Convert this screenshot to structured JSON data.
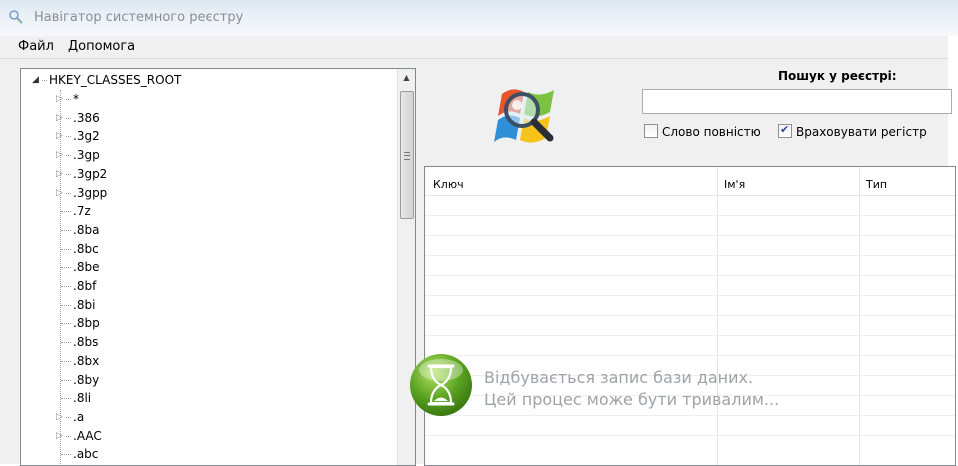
{
  "window": {
    "title": "Навігатор системного реєстру"
  },
  "menu": [
    {
      "label": "Файл"
    },
    {
      "label": "Допомога"
    }
  ],
  "tree": {
    "root": "HKEY_CLASSES_ROOT",
    "items": [
      {
        "label": "*",
        "expandable": true
      },
      {
        "label": ".386",
        "expandable": true
      },
      {
        "label": ".3g2",
        "expandable": true
      },
      {
        "label": ".3gp",
        "expandable": true
      },
      {
        "label": ".3gp2",
        "expandable": true
      },
      {
        "label": ".3gpp",
        "expandable": true
      },
      {
        "label": ".7z",
        "expandable": false
      },
      {
        "label": ".8ba",
        "expandable": false
      },
      {
        "label": ".8bc",
        "expandable": false
      },
      {
        "label": ".8be",
        "expandable": false
      },
      {
        "label": ".8bf",
        "expandable": false
      },
      {
        "label": ".8bi",
        "expandable": false
      },
      {
        "label": ".8bp",
        "expandable": false
      },
      {
        "label": ".8bs",
        "expandable": false
      },
      {
        "label": ".8bx",
        "expandable": false
      },
      {
        "label": ".8by",
        "expandable": false
      },
      {
        "label": ".8li",
        "expandable": false
      },
      {
        "label": ".a",
        "expandable": true
      },
      {
        "label": ".AAC",
        "expandable": true
      },
      {
        "label": ".abc",
        "expandable": false
      }
    ]
  },
  "search": {
    "label": "Пошук у реєстрі:",
    "value": "",
    "placeholder": "",
    "whole_word": {
      "label": "Слово повністю",
      "checked": false
    },
    "match_case": {
      "label": "Враховувати регістр",
      "checked": true
    }
  },
  "grid": {
    "columns": [
      "Ключ",
      "Ім'я",
      "Тип"
    ]
  },
  "busy": {
    "line1": "Відбувається запис бази даних.",
    "line2": "Цей процес може бути тривалим..."
  },
  "colors": {
    "menu_bg": "#f0f0f0",
    "border": "#828790",
    "busy_text": "#9da3a9",
    "busy_green": "#5aa321"
  }
}
